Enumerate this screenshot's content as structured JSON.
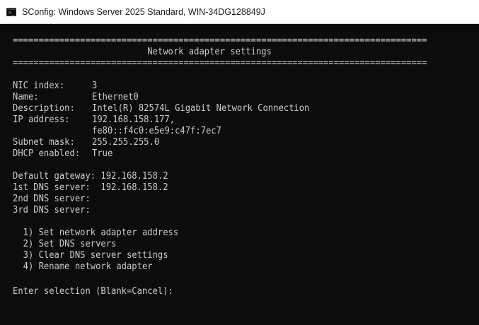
{
  "window": {
    "title": "SConfig: Windows Server 2025 Standard, WIN-34DG128849J",
    "icon": "console-icon"
  },
  "console": {
    "separator": "================================================================================",
    "heading": "                          Network adapter settings",
    "fields": [
      {
        "label": "NIC index:",
        "value": "3"
      },
      {
        "label": "Name:",
        "value": "Ethernet0"
      },
      {
        "label": "Description:",
        "value": "Intel(R) 82574L Gigabit Network Connection"
      },
      {
        "label": "IP address:",
        "value": "192.168.158.177,"
      },
      {
        "label": "",
        "value": "fe80::f4c0:e5e9:c47f:7ec7"
      },
      {
        "label": "Subnet mask:",
        "value": "255.255.255.0"
      },
      {
        "label": "DHCP enabled:",
        "value": "True"
      }
    ],
    "dns": [
      "Default gateway: 192.168.158.2",
      "1st DNS server:  192.168.158.2",
      "2nd DNS server:",
      "3rd DNS server:"
    ],
    "menu": [
      "  1) Set network adapter address",
      "  2) Set DNS servers",
      "  3) Clear DNS server settings",
      "  4) Rename network adapter"
    ],
    "prompt": "Enter selection (Blank=Cancel):"
  }
}
